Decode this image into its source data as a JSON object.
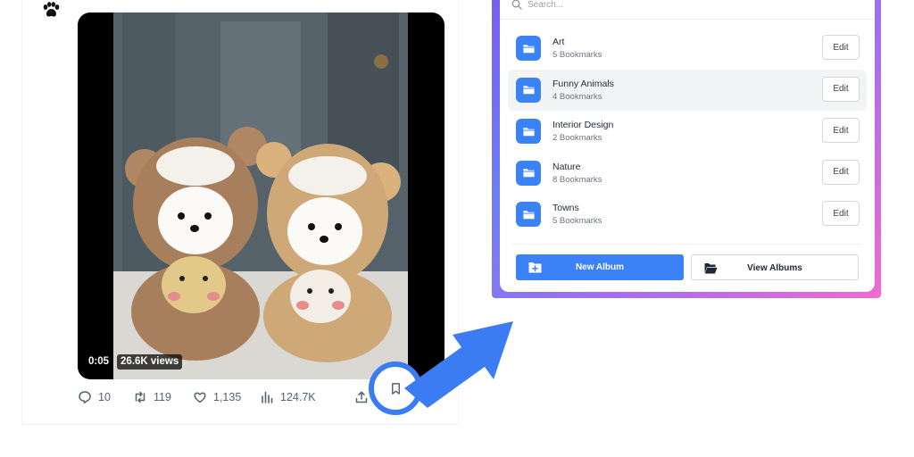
{
  "tweet": {
    "video": {
      "elapsed": "0:05",
      "views": "26.6K views"
    },
    "actions": {
      "replies": "10",
      "reposts": "119",
      "likes": "1,135",
      "views": "124.7K"
    }
  },
  "album_panel": {
    "search": {
      "placeholder": "Search..."
    },
    "albums": [
      {
        "name": "Art",
        "count": "5 Bookmarks",
        "edit_label": "Edit"
      },
      {
        "name": "Funny Animals",
        "count": "4 Bookmarks",
        "edit_label": "Edit"
      },
      {
        "name": "Interior Design",
        "count": "2 Bookmarks",
        "edit_label": "Edit"
      },
      {
        "name": "Nature",
        "count": "8 Bookmarks",
        "edit_label": "Edit"
      },
      {
        "name": "Towns",
        "count": "5 Bookmarks",
        "edit_label": "Edit"
      }
    ],
    "new_album_label": "New Album",
    "view_albums_label": "View Albums"
  },
  "colors": {
    "accent_blue": "#3b82f6",
    "highlight_ring": "#3b7cf2",
    "frame_gradient": [
      "#7a5cf2",
      "#f06bd0"
    ],
    "icon_grey": "#536471"
  },
  "icons": {
    "avatar": "paw-icon",
    "reply": "speech-bubble-icon",
    "repost": "repost-icon",
    "like": "heart-icon",
    "views": "bar-chart-icon",
    "share": "share-icon",
    "bookmark": "bookmark-icon",
    "search": "search-icon",
    "folder": "folder-icon"
  }
}
